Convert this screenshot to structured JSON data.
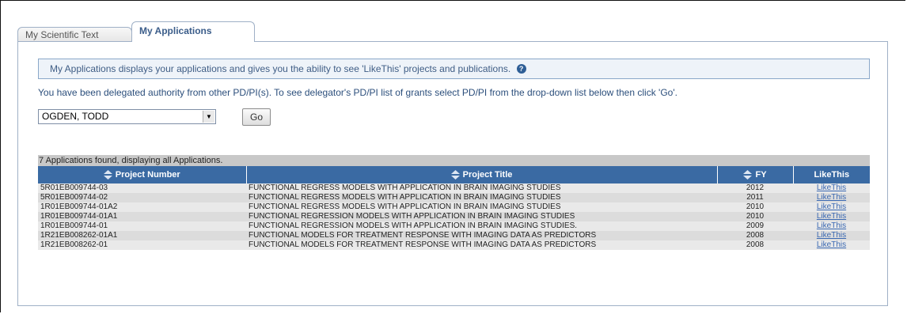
{
  "tabs": [
    {
      "label": "My Scientific Text",
      "active": false
    },
    {
      "label": "My Applications",
      "active": true
    }
  ],
  "info_text": "My Applications displays your applications and gives you the ability to see 'LikeThis' projects and publications.",
  "delegation_text": "You have been delegated authority from other PD/PI(s). To see delegator's PD/PI list of grants select PD/PI from the drop-down list below then click 'Go'.",
  "pdpi_select": {
    "selected": "OGDEN, TODD"
  },
  "go_label": "Go",
  "found_text": "7 Applications found, displaying all Applications.",
  "table": {
    "headers": [
      "Project Number",
      "Project Title",
      "FY",
      "LikeThis"
    ],
    "rows": [
      {
        "project_number": "5R01EB009744-03",
        "title": "FUNCTIONAL REGRESS MODELS WITH APPLICATION IN BRAIN IMAGING STUDIES",
        "fy": "2012",
        "link": "LikeThis"
      },
      {
        "project_number": "5R01EB009744-02",
        "title": "FUNCTIONAL REGRESS MODELS WITH APPLICATION IN BRAIN IMAGING STUDIES",
        "fy": "2011",
        "link": "LikeThis"
      },
      {
        "project_number": "1R01EB009744-01A2",
        "title": "FUNCTIONAL REGRESS MODELS WITH APPLICATION IN BRAIN IMAGING STUDIES",
        "fy": "2010",
        "link": "LikeThis"
      },
      {
        "project_number": "1R01EB009744-01A1",
        "title": "FUNCTIONAL REGRESSION MODELS WITH APPLICATION IN BRAIN IMAGING STUDIES",
        "fy": "2010",
        "link": "LikeThis"
      },
      {
        "project_number": "1R01EB009744-01",
        "title": "FUNCTIONAL REGRESSION MODELS WITH APPLICATION IN BRAIN IMAGING STUDIES.",
        "fy": "2009",
        "link": "LikeThis"
      },
      {
        "project_number": "1R21EB008262-01A1",
        "title": "FUNCTIONAL MODELS FOR TREATMENT RESPONSE WITH IMAGING DATA AS PREDICTORS",
        "fy": "2008",
        "link": "LikeThis"
      },
      {
        "project_number": "1R21EB008262-01",
        "title": "FUNCTIONAL MODELS FOR TREATMENT RESPONSE WITH IMAGING DATA AS PREDICTORS",
        "fy": "2008",
        "link": "LikeThis"
      }
    ]
  },
  "colors": {
    "header_bg": "#3a6aa3",
    "link": "#3a68b2",
    "info_bg": "#eef3f9"
  },
  "icons": {
    "help": "help-icon",
    "sort": "sort-updown-icon",
    "dropdown": "dropdown-arrow-icon"
  }
}
